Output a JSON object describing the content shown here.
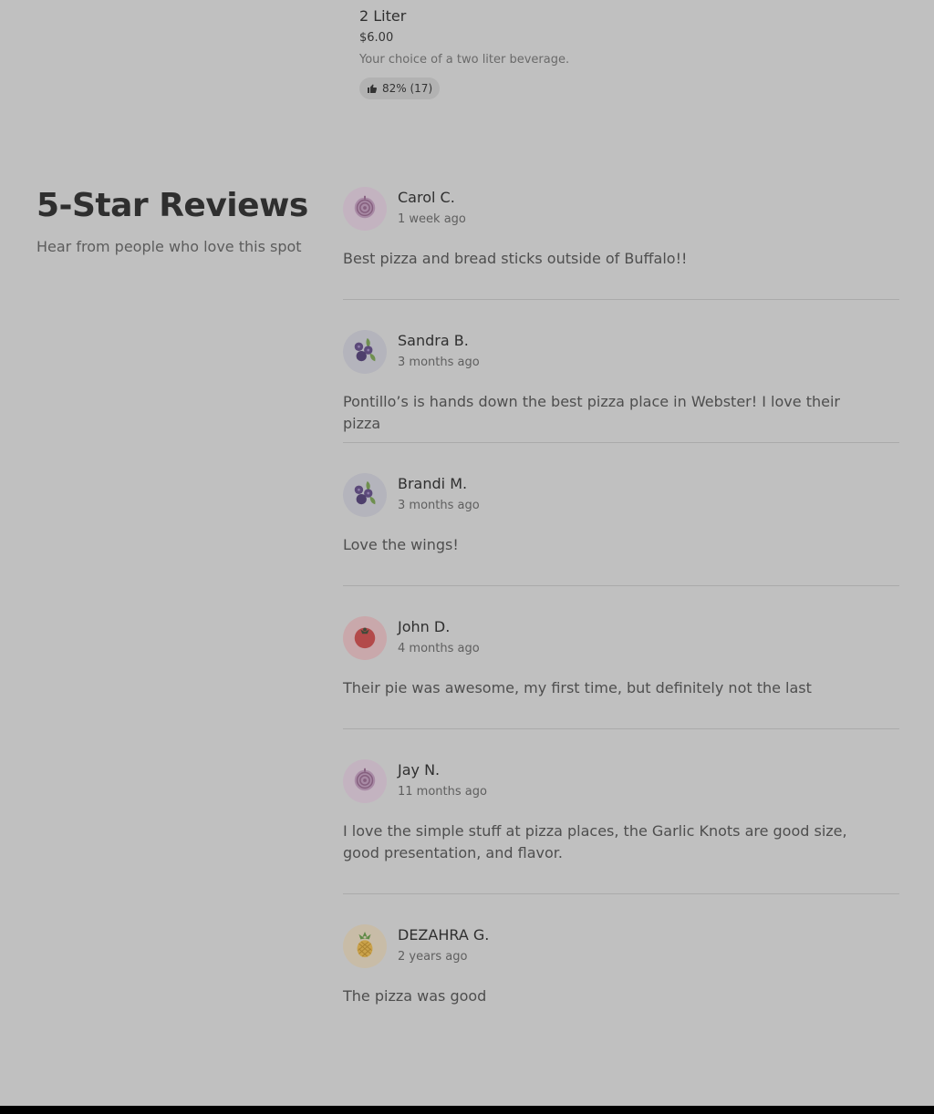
{
  "menu_item": {
    "name": "2 Liter",
    "price": "$6.00",
    "description": "Your choice of a two liter beverage.",
    "rating": "82% (17)",
    "rating_icon": "thumbs-up-icon"
  },
  "reviews_section": {
    "title": "5-Star Reviews",
    "subtitle": "Hear from people who love this spot",
    "reviews": [
      {
        "name": "Carol C.",
        "date": "1 week ago",
        "text": "Best pizza and bread sticks outside of Buffalo!!",
        "avatar": "onion-icon",
        "avatar_bg": "#c3b3c0"
      },
      {
        "name": "Sandra B.",
        "date": "3 months ago",
        "text": "Pontillo’s is hands down the best pizza place in Webster! I love their pizza",
        "avatar": "blueberry-icon",
        "avatar_bg": "#b4b4bc"
      },
      {
        "name": "Brandi M.",
        "date": "3 months ago",
        "text": "Love the wings!",
        "avatar": "blueberry-icon",
        "avatar_bg": "#b4b4bc"
      },
      {
        "name": "John D.",
        "date": "4 months ago",
        "text": "Their pie was awesome, my first time, but definitely not the last",
        "avatar": "tomato-icon",
        "avatar_bg": "#c9a8ab"
      },
      {
        "name": "Jay N.",
        "date": "11 months ago",
        "text": "I love the simple stuff at pizza places, the Garlic Knots are good size, good presentation, and flavor.",
        "avatar": "onion-icon",
        "avatar_bg": "#c3b3c0"
      },
      {
        "name": "DEZAHRA G.",
        "date": "2 years ago",
        "text": "The pizza was good",
        "avatar": "pineapple-icon",
        "avatar_bg": "#c8bca7"
      }
    ]
  }
}
